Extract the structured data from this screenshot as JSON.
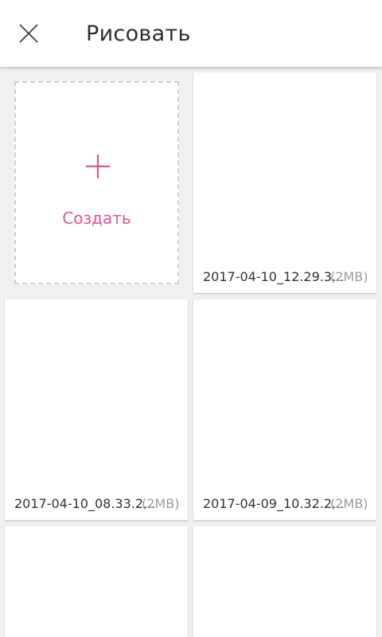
{
  "header": {
    "title": "Рисовать",
    "close_icon": "close-icon"
  },
  "create": {
    "label": "Создать",
    "icon": "plus-icon",
    "accent_color": "#e8508f"
  },
  "drawings": [
    {
      "name": "2017-04-10_12.29.3...",
      "size": "(2MB)"
    },
    {
      "name": "2017-04-10_08.33.2...",
      "size": "(2MB)"
    },
    {
      "name": "2017-04-09_10.32.2...",
      "size": "(2MB)"
    },
    {
      "name": "",
      "size": ""
    },
    {
      "name": "",
      "size": ""
    }
  ]
}
